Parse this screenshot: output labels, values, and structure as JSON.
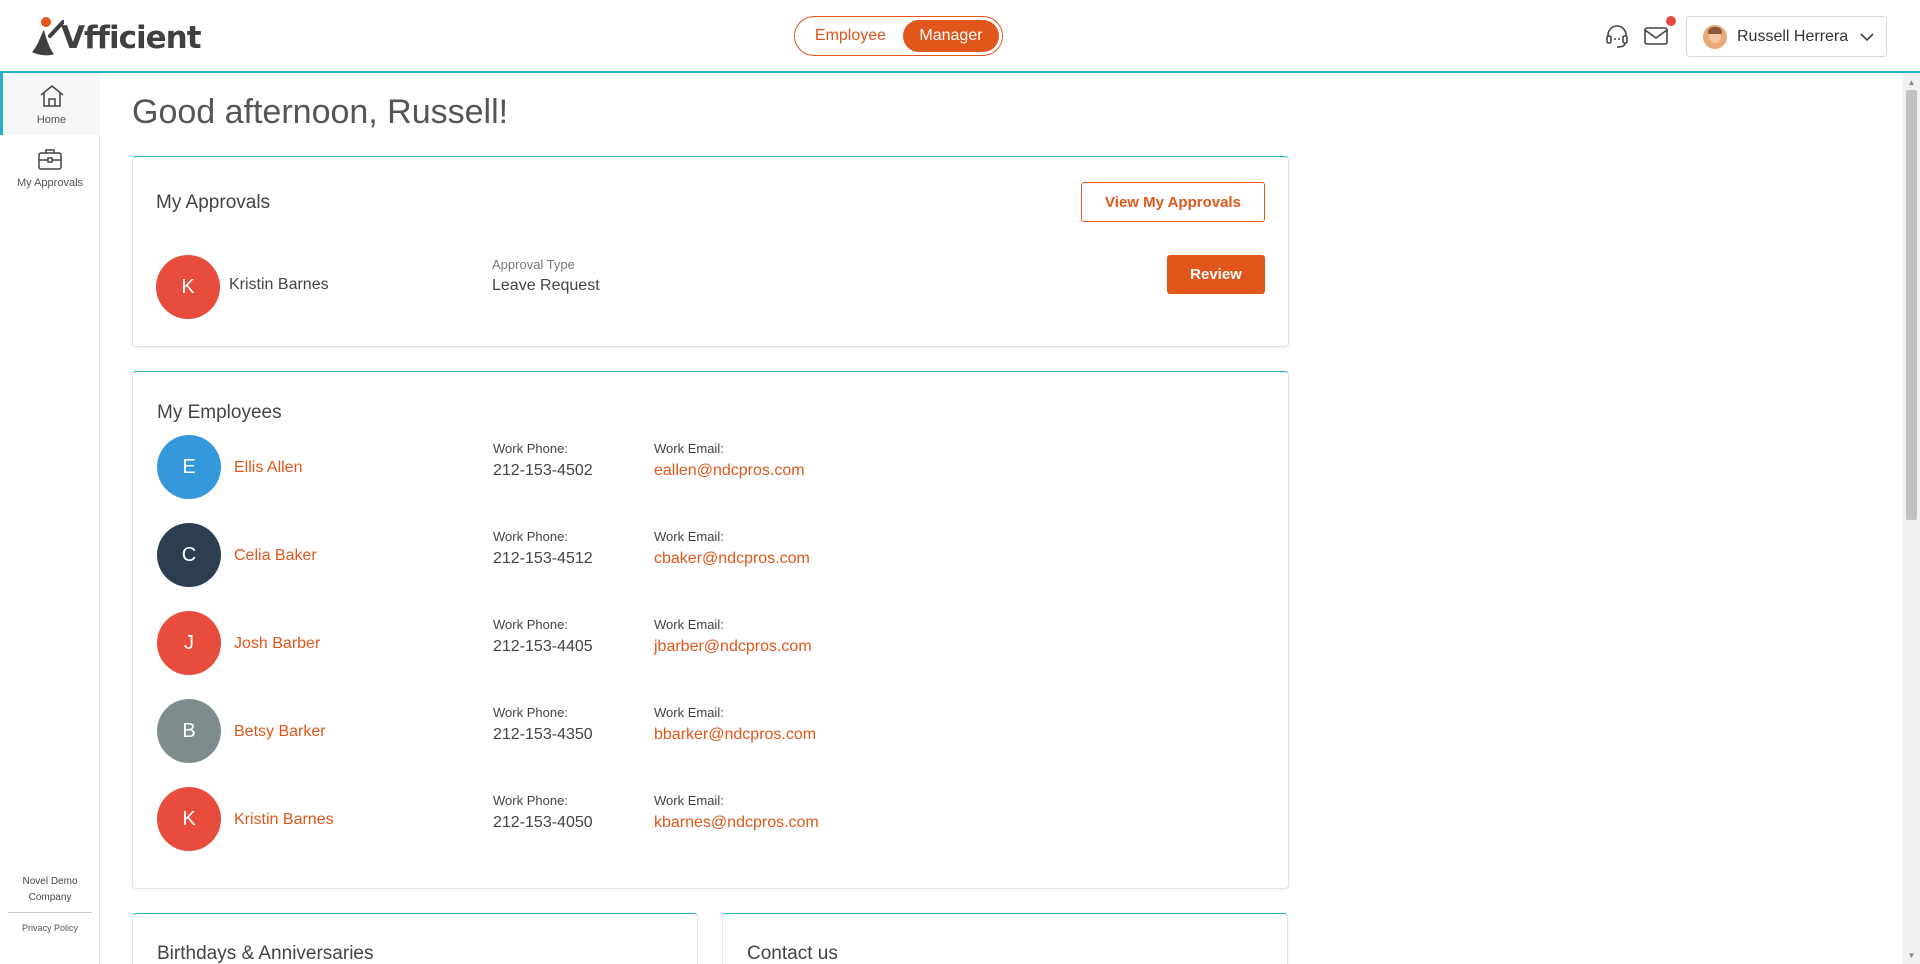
{
  "header": {
    "logo_text": "Vfficient",
    "mode_toggle": {
      "employee_label": "Employee",
      "manager_label": "Manager",
      "active": "Manager"
    },
    "support_icon": "headset-icon",
    "mail_icon": "mail-icon",
    "has_notification": true,
    "user_name": "Russell Herrera"
  },
  "sidebar": {
    "items": [
      {
        "label": "Home",
        "icon": "home-icon",
        "active": true
      },
      {
        "label": "My Approvals",
        "icon": "briefcase-icon",
        "active": false
      }
    ],
    "company": "Novel Demo Company",
    "privacy": "Privacy Policy"
  },
  "main": {
    "greeting": "Good afternoon, Russell!",
    "approvals": {
      "title": "My Approvals",
      "view_button": "View My Approvals",
      "items": [
        {
          "initial": "K",
          "name": "Kristin Barnes",
          "type_label": "Approval Type",
          "type": "Leave Request",
          "action": "Review",
          "color": "#e74c3c"
        }
      ]
    },
    "employees": {
      "title": "My Employees",
      "phone_label": "Work Phone:",
      "email_label": "Work Email:",
      "list": [
        {
          "initial": "E",
          "name": "Ellis Allen",
          "phone": "212-153-4502",
          "email": "eallen@ndcpros.com",
          "color": "#3498db"
        },
        {
          "initial": "C",
          "name": "Celia Baker",
          "phone": "212-153-4512",
          "email": "cbaker@ndcpros.com",
          "color": "#2c3e50"
        },
        {
          "initial": "J",
          "name": "Josh Barber",
          "phone": "212-153-4405",
          "email": "jbarber@ndcpros.com",
          "color": "#e74c3c"
        },
        {
          "initial": "B",
          "name": "Betsy Barker",
          "phone": "212-153-4350",
          "email": "bbarker@ndcpros.com",
          "color": "#7f8c8d"
        },
        {
          "initial": "K",
          "name": "Kristin Barnes",
          "phone": "212-153-4050",
          "email": "kbarnes@ndcpros.com",
          "color": "#e74c3c"
        }
      ]
    },
    "birthdays_title": "Birthdays & Anniversaries",
    "contact_title": "Contact us"
  },
  "colors": {
    "accent": "#e0561b",
    "teal": "#26b0c4"
  }
}
